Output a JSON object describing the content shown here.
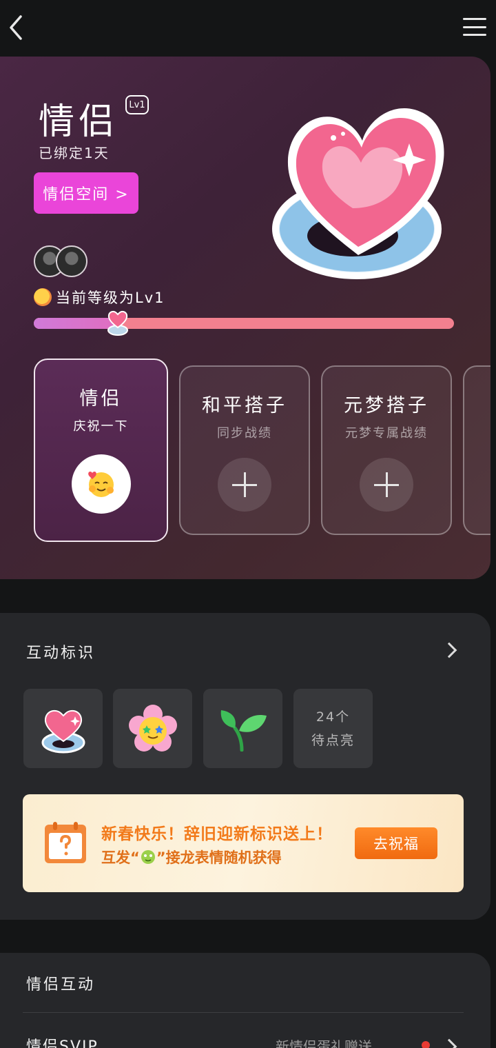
{
  "topbar": {
    "back_icon": "chevron-left-icon",
    "menu_icon": "hamburger-menu-icon"
  },
  "hero": {
    "title": "情侣",
    "level_badge": "Lv1",
    "bind_status": "已绑定1天",
    "space_button": "情侣空间 >",
    "level_text": "当前等级为Lv1",
    "progress": 0.2,
    "colors": {
      "space_button": "#ea45d9",
      "progress_track": "#f3808f"
    }
  },
  "cards": [
    {
      "title": "情侣",
      "subtitle": "庆祝一下",
      "active": true
    },
    {
      "title": "和平搭子",
      "subtitle": "同步战绩",
      "active": false
    },
    {
      "title": "元梦搭子",
      "subtitle": "元梦专属战绩",
      "active": false
    }
  ],
  "marks": {
    "title": "互动标识",
    "icons": [
      "heart-ring-icon",
      "flower-face-icon",
      "sprout-icon"
    ],
    "count_line1": "24个",
    "count_line2": "待点亮",
    "promo": {
      "line1": "新春快乐！辞旧迎新标识送上！",
      "line2_pre": "互发“",
      "line2_post": "”接龙表情随机获得",
      "button": "去祝福"
    }
  },
  "couple": {
    "title": "情侣互动",
    "row_label": "情侣SVIP",
    "row_value": "新情侣蛋礼赠送"
  }
}
